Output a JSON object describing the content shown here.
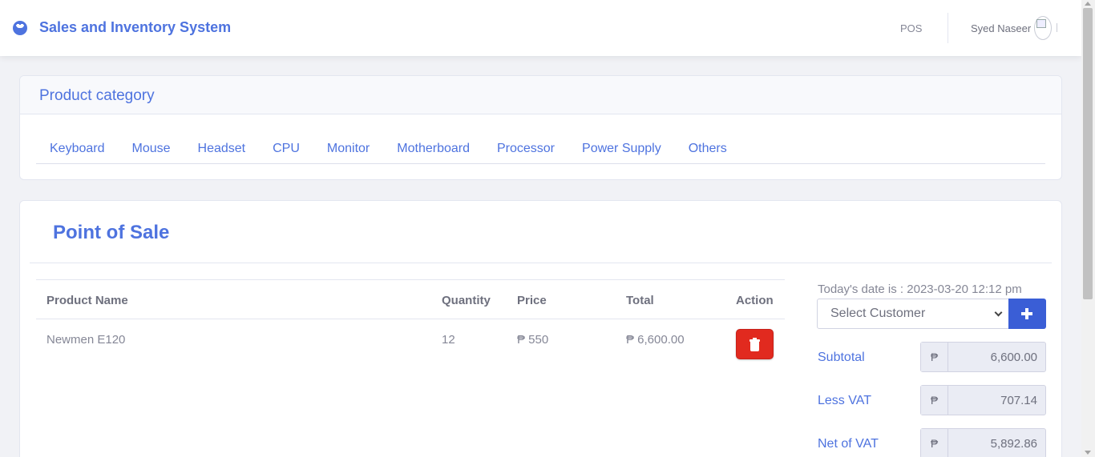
{
  "header": {
    "brand_icon": "laugh-face-icon",
    "title": "Sales and Inventory System",
    "nav_pos": "POS",
    "user_name": "Syed Naseer"
  },
  "category": {
    "title": "Product category",
    "tabs": [
      "Keyboard",
      "Mouse",
      "Headset",
      "CPU",
      "Monitor",
      "Motherboard",
      "Processor",
      "Power Supply",
      "Others"
    ]
  },
  "pos": {
    "title": "Point of Sale",
    "columns": [
      "Product Name",
      "Quantity",
      "Price",
      "Total",
      "Action"
    ],
    "rows": [
      {
        "product": "Newmen E120",
        "quantity": "12",
        "price": "₱ 550",
        "total": "₱ 6,600.00",
        "action_icon": "trash-icon"
      }
    ],
    "date_text": "Today's date is : 2023-03-20 12:12 pm",
    "customer_select": "Select Customer",
    "add_customer_icon": "plus-icon",
    "currency": "₱",
    "summary": [
      {
        "label": "Subtotal",
        "value": "6,600.00"
      },
      {
        "label": "Less VAT",
        "value": "707.14"
      },
      {
        "label": "Net of VAT",
        "value": "5,892.86"
      }
    ]
  },
  "colors": {
    "primary": "#4e73df",
    "danger": "#e12a1f",
    "background": "#f1f2f6"
  }
}
